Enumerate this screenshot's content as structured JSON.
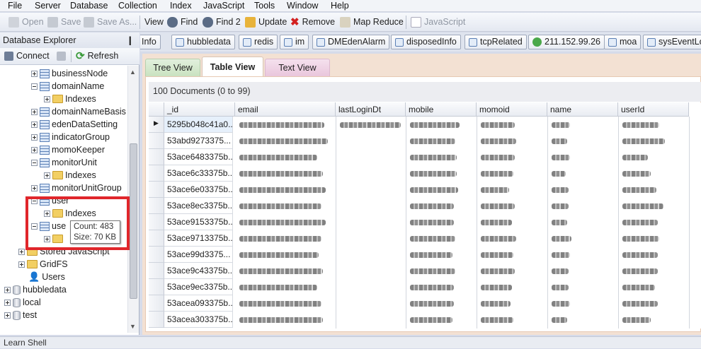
{
  "menu": [
    "File",
    "Server",
    "Database",
    "Collection",
    "Index",
    "JavaScript",
    "Tools",
    "Window",
    "Help"
  ],
  "toolbar": {
    "open": "Open",
    "save": "Save",
    "save_as": "Save As...",
    "view": "View",
    "find": "Find",
    "find2": "Find 2",
    "update": "Update",
    "remove": "Remove",
    "map_reduce": "Map Reduce",
    "javascript": "JavaScript"
  },
  "db_tabs": [
    "Info",
    "hubbledata",
    "redis",
    "im",
    "DMEdenAlarm",
    "disposedInfo",
    "tcpRelated",
    "211.152.99.26",
    "moa",
    "sysEventLo"
  ],
  "explorer": {
    "title": "Database Explorer",
    "pin": "❙",
    "connect": "Connect",
    "refresh": "Refresh"
  },
  "tree": [
    {
      "label": "businessNode"
    },
    {
      "label": "domainName"
    },
    {
      "label": "Indexes"
    },
    {
      "label": "domainNameBasis"
    },
    {
      "label": "edenDataSetting"
    },
    {
      "label": "indicatorGroup"
    },
    {
      "label": "momoKeeper"
    },
    {
      "label": "monitorUnit"
    },
    {
      "label": "Indexes"
    },
    {
      "label": "monitorUnitGroup"
    },
    {
      "label": "user"
    },
    {
      "label": "Indexes"
    },
    {
      "label": "use"
    },
    {
      "label": ""
    },
    {
      "label": "Stored JavaScript"
    },
    {
      "label": "GridFS"
    },
    {
      "label": "Users"
    },
    {
      "label": "hubbledata"
    },
    {
      "label": "local"
    },
    {
      "label": "test"
    }
  ],
  "tooltip": {
    "count": "Count: 483",
    "size": "Size: 70 KB"
  },
  "view_tabs": {
    "tree": "Tree View",
    "table": "Table View",
    "text": "Text View"
  },
  "docs_header": "100 Documents (0 to 99)",
  "columns": [
    "_id",
    "email",
    "lastLoginDt",
    "mobile",
    "momoid",
    "name",
    "userId"
  ],
  "rows": [
    "5295b048c41a0...",
    "53abd9273375...",
    "53ace6483375b...",
    "53ace6c33375b...",
    "53ace6e03375b...",
    "53ace8ec3375b...",
    "53ace9153375b...",
    "53ace9713375b...",
    "53ace99d3375...",
    "53ace9c43375b...",
    "53ace9ec3375b...",
    "53acea093375b...",
    "53acea303375b..."
  ],
  "status": "Learn Shell",
  "colors": {
    "accent": "#e0262b",
    "tab_active": "#ffffff",
    "content_bg": "#f3e1d3"
  }
}
